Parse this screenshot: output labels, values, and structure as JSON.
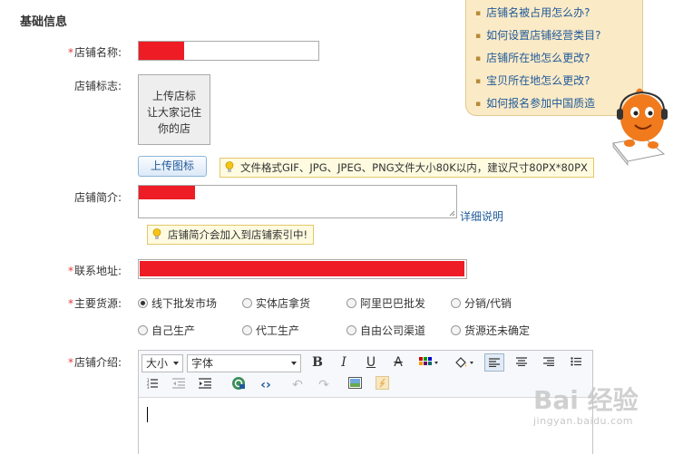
{
  "section": {
    "title": "基础信息"
  },
  "fields": {
    "shop_name_label": "店铺名称:",
    "shop_logo_label": "店铺标志:",
    "shop_intro_label": "店铺简介:",
    "contact_address_label": "联系地址:",
    "main_source_label": "主要货源:",
    "shop_desc_label": "店铺介绍:"
  },
  "logo": {
    "placeholder_lines": [
      "上传店标",
      "让大家记住",
      "你的店"
    ],
    "upload_button": "上传图标",
    "tip": "文件格式GIF、JPG、JPEG、PNG文件大小80K以内，建议尺寸80PX*80PX"
  },
  "intro": {
    "detail_link": "详细说明",
    "tip": "店铺简介会加入到店铺索引中!"
  },
  "sources": {
    "options": [
      "线下批发市场",
      "实体店拿货",
      "阿里巴巴批发",
      "分销/代销",
      "自己生产",
      "代工生产",
      "自由公司渠道",
      "货源还未确定"
    ],
    "selected": "线下批发市场"
  },
  "editor": {
    "size_label": "大小",
    "font_label": "字体",
    "icons": [
      "bold-icon",
      "italic-icon",
      "underline-icon",
      "strikethrough-icon",
      "text-color-icon",
      "background-color-icon",
      "align-left-icon",
      "align-center-icon",
      "align-right-icon",
      "unordered-list-icon",
      "ordered-list-icon",
      "outdent-icon",
      "indent-icon",
      "insert-link-icon",
      "source-code-icon",
      "undo-icon",
      "redo-icon",
      "insert-image-icon",
      "insert-flash-icon"
    ]
  },
  "help": {
    "items": [
      "店铺名被占用怎么办?",
      "如何设置店铺经营类目?",
      "店铺所在地怎么更改?",
      "宝贝所在地怎么更改?",
      "如何报名参加中国质造"
    ]
  },
  "watermark": {
    "logo": "Bai 经验",
    "url": "jingyan.baidu.com"
  },
  "colors": {
    "required": "#e4393c",
    "redacted": "#ee1c25",
    "link": "#1f5a9a",
    "tip_bg": "#fffbe0",
    "bubble_bg": "#fbeac6",
    "mascot": "#f07a1c"
  }
}
